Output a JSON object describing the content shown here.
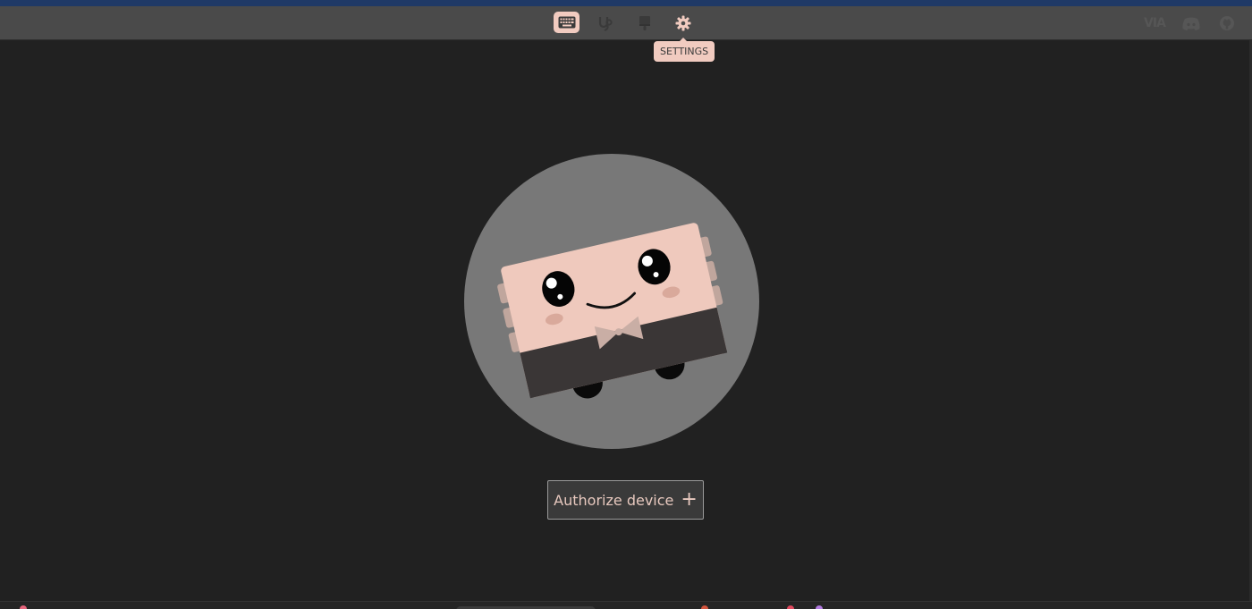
{
  "toolbar": {
    "tabs": [
      {
        "id": "configure",
        "icon": "keyboard-icon",
        "active": true
      },
      {
        "id": "test",
        "icon": "vial-icon",
        "active": false
      },
      {
        "id": "design",
        "icon": "brush-icon",
        "active": false
      },
      {
        "id": "settings",
        "icon": "gear-icon",
        "active": false
      }
    ],
    "right_links": [
      {
        "id": "via",
        "icon": "via-logo-icon",
        "text": "VIA"
      },
      {
        "id": "discord",
        "icon": "discord-icon"
      },
      {
        "id": "github",
        "icon": "github-icon"
      }
    ]
  },
  "tooltip": {
    "text": "SETTINGS"
  },
  "main": {
    "authorize_label": "Authorize device",
    "authorize_icon": "plus-icon",
    "authorize_symbol": "+"
  },
  "colors": {
    "accent": "#f1cbc0",
    "background": "#212121",
    "toolbar": "#4a4a4a",
    "top_accent": "#1f3966",
    "button_text": "#e8c9bf"
  }
}
